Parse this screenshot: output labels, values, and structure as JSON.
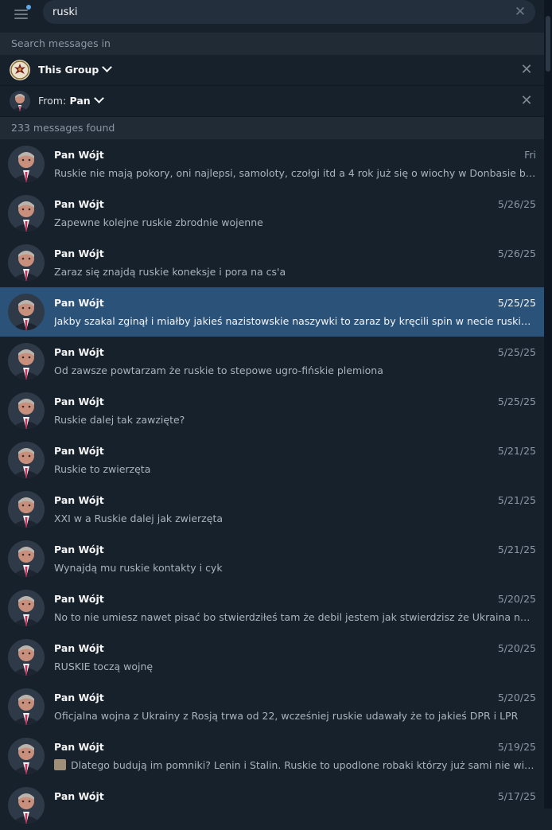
{
  "search": {
    "value": "ruski",
    "clear_icon": "close-icon"
  },
  "search_in": {
    "header": "Search messages in"
  },
  "filters": {
    "scope_label": "This Group",
    "from_prefix": "From:",
    "from_value": "Pan"
  },
  "results": {
    "count_label": "233 messages found",
    "items": [
      {
        "name": "Pan Wójt",
        "date": "Fri",
        "text": "Ruskie nie mają pokory, oni najlepsi, samoloty, czołgi itd a 4 rok już się o wiochy w Donbasie biją"
      },
      {
        "name": "Pan Wójt",
        "date": "5/26/25",
        "text": "Zapewne kolejne ruskie zbrodnie wojenne"
      },
      {
        "name": "Pan Wójt",
        "date": "5/26/25",
        "text": "Zaraz się znajdą ruskie koneksje i pora na cs'a"
      },
      {
        "name": "Pan Wójt",
        "date": "5/25/25",
        "text": "Jakby szakal zginął i miałby jakieś nazistowskie naszywki to zaraz by kręcili spin w necie ruskie i polskie media",
        "active": true
      },
      {
        "name": "Pan Wójt",
        "date": "5/25/25",
        "text": "Od zawsze powtarzam że ruskie to stepowe ugro-fińskie plemiona"
      },
      {
        "name": "Pan Wójt",
        "date": "5/25/25",
        "text": "Ruskie dalej tak zawzięte?"
      },
      {
        "name": "Pan Wójt",
        "date": "5/21/25",
        "text": "Ruskie to zwierzęta"
      },
      {
        "name": "Pan Wójt",
        "date": "5/21/25",
        "text": "XXI w a Ruskie dalej jak zwierzęta"
      },
      {
        "name": "Pan Wójt",
        "date": "5/21/25",
        "text": "Wynajdą mu ruskie kontakty i cyk"
      },
      {
        "name": "Pan Wójt",
        "date": "5/20/25",
        "text": "No to nie umiesz nawet pisać bo stwierdziłeś tam że debil jestem jak stwierdzisz że Ukraina napadła Rosję"
      },
      {
        "name": "Pan Wójt",
        "date": "5/20/25",
        "text": "RUSKIE toczą wojnę"
      },
      {
        "name": "Pan Wójt",
        "date": "5/20/25",
        "text": "Oficjalna wojna z Ukrainy z Rosją trwa od 22, wcześniej ruskie udawały że to jakieś DPR i LPR"
      },
      {
        "name": "Pan Wójt",
        "date": "5/19/25",
        "text": "Dlatego budują im pomniki? Lenin i Stalin. Ruskie to upodlone robaki którzy już sami nie wiedzą kim są",
        "has_thumb": true
      },
      {
        "name": "Pan Wójt",
        "date": "5/17/25",
        "text": ""
      }
    ]
  }
}
